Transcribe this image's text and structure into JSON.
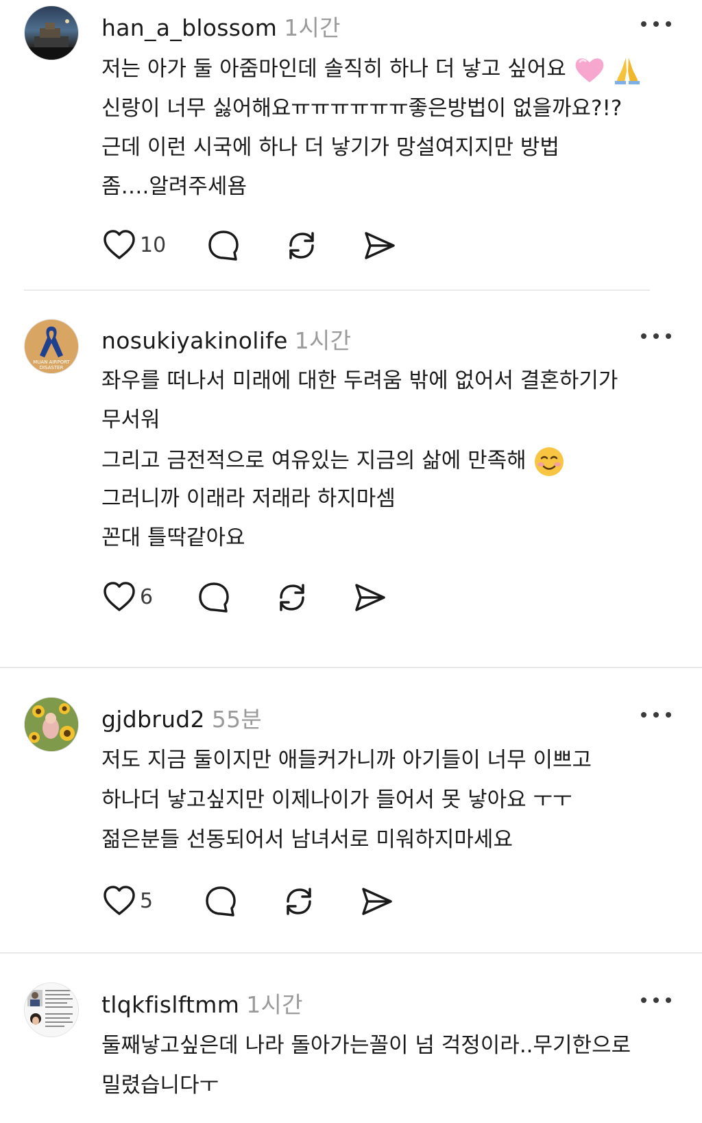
{
  "posts": [
    {
      "username": "han_a_blossom",
      "time": "1시간",
      "lines": [
        "저는 아가 둘 아줌마인데 솔직히 하나 더 낳고 싶어요",
        "신랑이 너무 싫어해요ㅠㅠㅠㅠㅠㅠ좋은방법이 없을까요?!?",
        "근데 이런 시국에 하나 더 낳기가 망설여지지만 방법",
        "좀….알려주세욤"
      ],
      "likes": "10",
      "avatar_icon": "night-city-photo-avatar"
    },
    {
      "username": "nosukiyakinolife",
      "time": "1시간",
      "lines": [
        "좌우를 떠나서 미래에 대한 두려움 밖에 없어서 결혼하기가",
        "무서워",
        "그리고 금전적으로 여유있는 지금의 삶에 만족해",
        "그러니까 이래라 저래라 하지마셈",
        "꼰대 틀딱같아요"
      ],
      "likes": "6",
      "avatar_text": "MUAN AIRPORT DISASTER",
      "avatar_icon": "blue-ribbon-avatar"
    },
    {
      "username": "gjdbrud2",
      "time": "55분",
      "lines": [
        "저도 지금 둘이지만 애들커가니까  아기들이 너무 이쁘고",
        "하나더 낳고싶지만 이제나이가 들어서 못 낳아요 ㅜㅜ",
        "젊은분들 선동되어서 남녀서로 미워하지마세요"
      ],
      "likes": "5",
      "avatar_icon": "sunflower-photo-avatar"
    },
    {
      "username": "tlqkfislftmm",
      "time": "1시간",
      "lines": [
        "둘째낳고싶은데 나라 돌아가는꼴이 넘 걱정이라..무기한으로",
        "밀렸습니다ㅜ"
      ],
      "avatar_icon": "document-collage-avatar"
    }
  ],
  "icons": {
    "like": "heart-icon",
    "reply": "speech-bubble-icon",
    "repost": "repost-icon",
    "share": "send-icon",
    "more": "more-dots-icon"
  }
}
